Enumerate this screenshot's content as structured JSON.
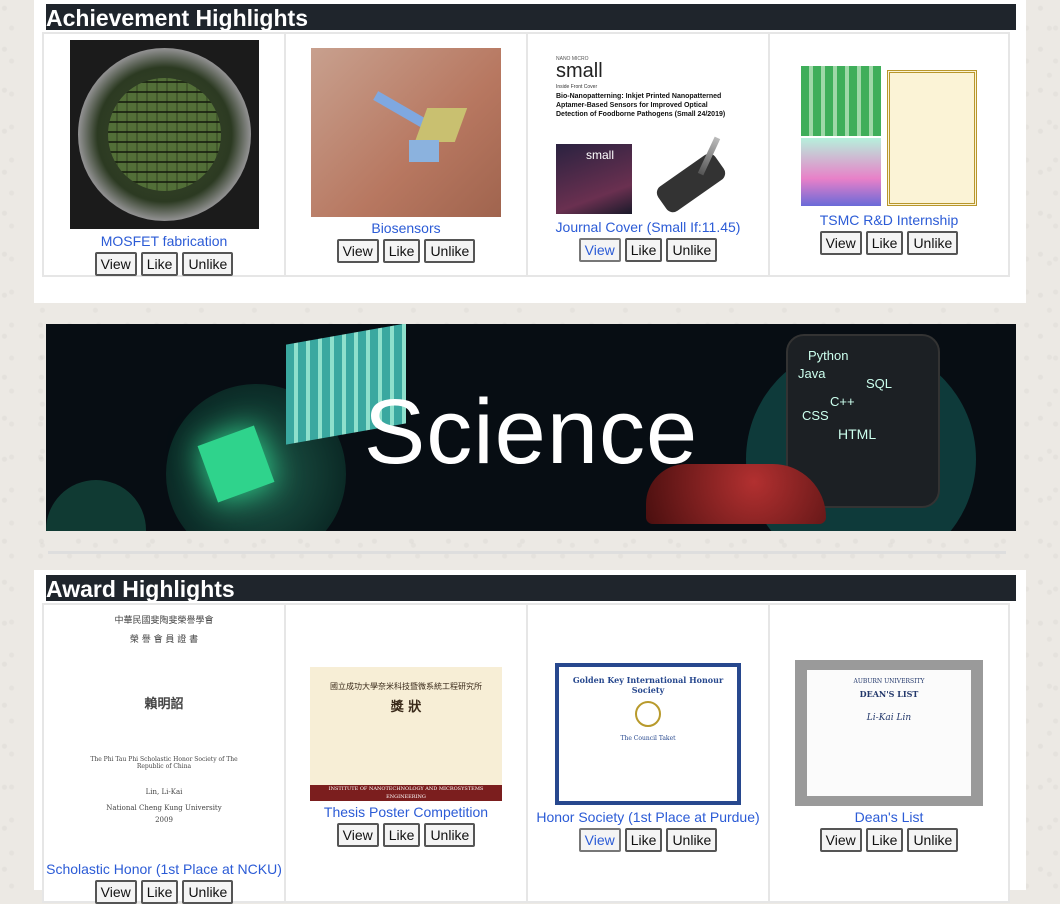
{
  "achievements": {
    "title": "Achievement Highlights",
    "items": [
      {
        "caption": "MOSFET fabrication",
        "view": "View",
        "like": "Like",
        "unlike": "Unlike"
      },
      {
        "caption": "Biosensors",
        "view": "View",
        "like": "Like",
        "unlike": "Unlike"
      },
      {
        "caption": "Journal Cover (Small If:11.45)",
        "view": "View",
        "like": "Like",
        "unlike": "Unlike",
        "image_text": {
          "brand": "small",
          "top": "NANO MICRO",
          "inside": "Inside Front Cover",
          "headline": "Bio-Nanopatterning: Inkjet Printed Nanopatterned Aptamer-Based Sensors for Improved Optical Detection of Foodborne Pathogens (Small 24/2019)"
        }
      },
      {
        "caption": "TSMC R&D Internship",
        "view": "View",
        "like": "Like",
        "unlike": "Unlike"
      }
    ]
  },
  "banner": {
    "text": "Science",
    "langs": [
      "Python",
      "Java",
      "SQL",
      "C++",
      "CSS",
      "HTML"
    ]
  },
  "awards": {
    "title": "Award Highlights",
    "items": [
      {
        "caption": "Scholastic Honor (1st Place at NCKU)",
        "view": "View",
        "like": "Like",
        "unlike": "Unlike",
        "image_text": {
          "header": "中華民國斐陶斐榮譽學會",
          "sub": "榮 譽 會 員 證 書",
          "name": "賴明詔",
          "line1": "The Phi Tau Phi Scholastic Honor Society of The Republic of China",
          "line2": "Lin, Li-Kai",
          "line3": "National Cheng Kung University",
          "year": "2009"
        }
      },
      {
        "caption": "Thesis Poster Competition",
        "view": "View",
        "like": "Like",
        "unlike": "Unlike",
        "image_text": {
          "header": "國立成功大學奈米科技暨微系統工程研究所",
          "title": "獎 狀",
          "footer": "INSTITUTE OF NANOTECHNOLOGY AND MICROSYSTEMS ENGINEERING"
        }
      },
      {
        "caption": "Honor Society (1st Place at Purdue)",
        "view": "View",
        "like": "Like",
        "unlike": "Unlike",
        "image_text": {
          "header": "Golden Key International Honour Society",
          "body": "The Council Taket"
        }
      },
      {
        "caption": "Dean's List",
        "view": "View",
        "like": "Like",
        "unlike": "Unlike",
        "image_text": {
          "header": "AUBURN UNIVERSITY",
          "title": "DEAN'S LIST",
          "name": "Li-Kai Lin"
        }
      }
    ]
  },
  "colors": {
    "link": "#2b5bd6",
    "title_bar": "#1f252c",
    "banner_bg": "#070d13"
  }
}
